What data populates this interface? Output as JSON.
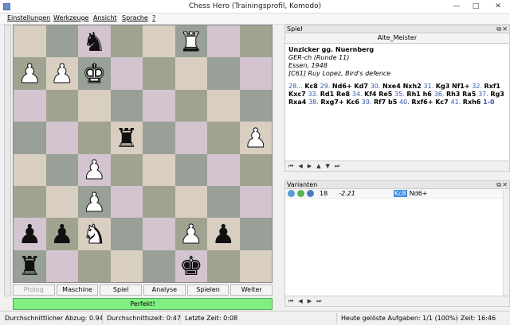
{
  "window": {
    "title": "Chess Hero (Trainingsprofil, Komodo)"
  },
  "menu": [
    "Einstellungen",
    "Werkzeuge",
    "Ansicht",
    "Sprache",
    "?"
  ],
  "board": {
    "rows": [
      [
        {
          "p": "",
          "c": ""
        },
        {
          "p": "",
          "c": ""
        },
        {
          "p": "♞",
          "c": "b"
        },
        {
          "p": "",
          "c": ""
        },
        {
          "p": "",
          "c": ""
        },
        {
          "p": "♜",
          "c": "w"
        },
        {
          "p": "",
          "c": ""
        },
        {
          "p": "",
          "c": ""
        }
      ],
      [
        {
          "p": "♟",
          "c": "w"
        },
        {
          "p": "♟",
          "c": "w"
        },
        {
          "p": "♚",
          "c": "w"
        },
        {
          "p": "",
          "c": ""
        },
        {
          "p": "",
          "c": ""
        },
        {
          "p": "",
          "c": ""
        },
        {
          "p": "",
          "c": ""
        },
        {
          "p": "",
          "c": ""
        }
      ],
      [
        {
          "p": "",
          "c": ""
        },
        {
          "p": "",
          "c": ""
        },
        {
          "p": "",
          "c": ""
        },
        {
          "p": "",
          "c": ""
        },
        {
          "p": "",
          "c": ""
        },
        {
          "p": "",
          "c": ""
        },
        {
          "p": "",
          "c": ""
        },
        {
          "p": "",
          "c": ""
        }
      ],
      [
        {
          "p": "",
          "c": ""
        },
        {
          "p": "",
          "c": ""
        },
        {
          "p": "",
          "c": ""
        },
        {
          "p": "♜",
          "c": "b"
        },
        {
          "p": "",
          "c": ""
        },
        {
          "p": "",
          "c": ""
        },
        {
          "p": "",
          "c": ""
        },
        {
          "p": "♟",
          "c": "w"
        }
      ],
      [
        {
          "p": "",
          "c": ""
        },
        {
          "p": "",
          "c": ""
        },
        {
          "p": "♟",
          "c": "w"
        },
        {
          "p": "",
          "c": ""
        },
        {
          "p": "",
          "c": ""
        },
        {
          "p": "",
          "c": ""
        },
        {
          "p": "",
          "c": ""
        },
        {
          "p": "",
          "c": ""
        }
      ],
      [
        {
          "p": "",
          "c": ""
        },
        {
          "p": "",
          "c": ""
        },
        {
          "p": "♟",
          "c": "w"
        },
        {
          "p": "",
          "c": ""
        },
        {
          "p": "",
          "c": ""
        },
        {
          "p": "",
          "c": ""
        },
        {
          "p": "",
          "c": ""
        },
        {
          "p": "",
          "c": ""
        }
      ],
      [
        {
          "p": "♟",
          "c": "b"
        },
        {
          "p": "♟",
          "c": "b"
        },
        {
          "p": "♞",
          "c": "w"
        },
        {
          "p": "",
          "c": ""
        },
        {
          "p": "",
          "c": ""
        },
        {
          "p": "♟",
          "c": "w"
        },
        {
          "p": "♟",
          "c": "b"
        },
        {
          "p": "",
          "c": ""
        }
      ],
      [
        {
          "p": "♜",
          "c": "b"
        },
        {
          "p": "",
          "c": ""
        },
        {
          "p": "",
          "c": ""
        },
        {
          "p": "",
          "c": ""
        },
        {
          "p": "",
          "c": ""
        },
        {
          "p": "♚",
          "c": "b"
        },
        {
          "p": "",
          "c": ""
        },
        {
          "p": "",
          "c": ""
        }
      ]
    ]
  },
  "tabs": [
    "Prolog",
    "Maschine",
    "Spiel",
    "Analyse",
    "Spielen",
    "Weiter"
  ],
  "status_text": "Perfekt!",
  "game_panel": {
    "header": "Spiel",
    "subtitle": "Alte_Meister",
    "players": "Unzicker gg. Nuernberg",
    "event": "GER-ch (Runde 11)",
    "place": "Essen, 1948",
    "opening": "[C61] Ruy Lopez, Bird's defence",
    "moves": [
      {
        "n": "28...",
        "m": "Kc8"
      },
      {
        "n": "29.",
        "m": "Nd6+ Kd7"
      },
      {
        "n": "30.",
        "m": "Nxe4 Nxh2"
      },
      {
        "n": "31.",
        "m": "Kg3 Nf1+"
      },
      {
        "n": "32.",
        "m": "Rxf1 Kxc7"
      },
      {
        "n": "33.",
        "m": "Rd1 Re8"
      },
      {
        "n": "34.",
        "m": "Kf4 Re5"
      },
      {
        "n": "35.",
        "m": "Rh1 h6"
      },
      {
        "n": "36.",
        "m": "Rh3 Ra5"
      },
      {
        "n": "37.",
        "m": "Rg3 Rxa4"
      },
      {
        "n": "38.",
        "m": "Rxg7+ Kc6"
      },
      {
        "n": "39.",
        "m": "Rf7 b5"
      },
      {
        "n": "40.",
        "m": "Rxf6+ Kc7"
      },
      {
        "n": "41.",
        "m": "Rxh6"
      }
    ],
    "result": "1-0"
  },
  "variants_panel": {
    "header": "Varianten",
    "row": {
      "depth": "18",
      "score": "-2.21",
      "move_hl": "Kc8",
      "move": "Nd6+"
    }
  },
  "footer": {
    "avg_loss": "Durchschnittlicher Abzug: 0.94",
    "avg_time": "Durchschnittszeit: 0:47",
    "last_time": "Letzte Zeit: 0:08",
    "solved": "Heute gelöste Aufgaben: 1/1 (100%)",
    "time": "Zeit: 16:46"
  },
  "icons": {
    "nav_first": "first-icon",
    "nav_prev": "prev-icon",
    "nav_next": "next-icon",
    "nav_last": "last-icon"
  }
}
